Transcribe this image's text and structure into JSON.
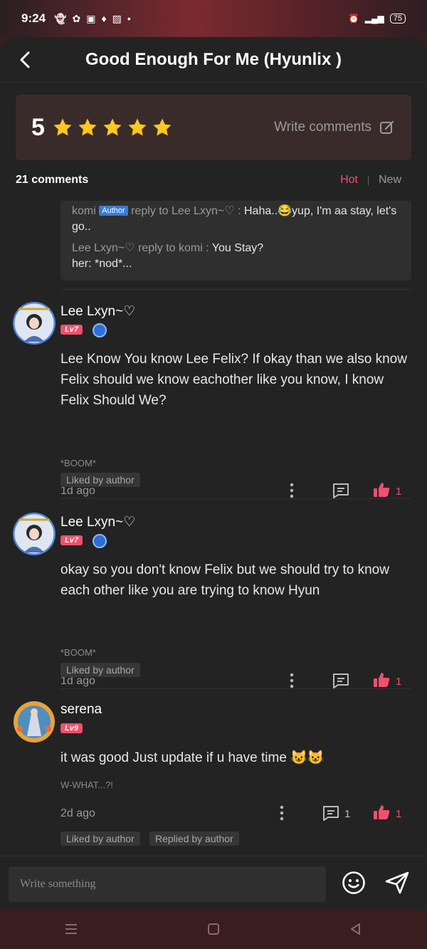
{
  "status": {
    "time": "9:24",
    "battery": "75"
  },
  "header": {
    "title": "Good Enough For Me (Hyunlix )"
  },
  "rating": {
    "value": "5",
    "stars": 5,
    "write_label": "Write comments"
  },
  "comments_header": {
    "count": "21 comments",
    "sort_hot": "Hot",
    "sort_new": "New"
  },
  "replies": [
    {
      "user": "komi",
      "tag": "Author",
      "prefix": " reply to Lee Lxyn~♡ : ",
      "text": "Haha..😂yup, I'm aa stay, let's go.."
    },
    {
      "user": "Lee Lxyn~♡",
      "prefix": " reply to komi : ",
      "text": "You Stay?",
      "text2": "her: *nod*..."
    }
  ],
  "comments": [
    {
      "name": "Lee Lxyn~♡",
      "level": "Lv7",
      "text": "Lee Know You know Lee Felix? If okay than we also know Felix should we know eachother like you know, I know Felix Should We?",
      "note": "*BOOM*",
      "time": "1d ago",
      "likes": "1",
      "tags": [
        "Liked by author"
      ]
    },
    {
      "name": "Lee Lxyn~♡",
      "level": "Lv7",
      "text": "okay so you don't know Felix but we should try to know each other like you are trying to know Hyun",
      "note": "*BOOM*",
      "time": "1d ago",
      "likes": "1",
      "tags": [
        "Liked by author"
      ]
    },
    {
      "name": "serena",
      "level": "Lv9",
      "text": "it was good Just update if u have time 😺😺",
      "note": "W-WHAT...?!",
      "time": "2d ago",
      "replies": "1",
      "likes": "1",
      "tags": [
        "Liked by author",
        "Replied by author"
      ]
    }
  ],
  "composer": {
    "placeholder": "Write something"
  },
  "colors": {
    "accent": "#f0506e",
    "star": "#ffc81e",
    "background": "#232323"
  }
}
